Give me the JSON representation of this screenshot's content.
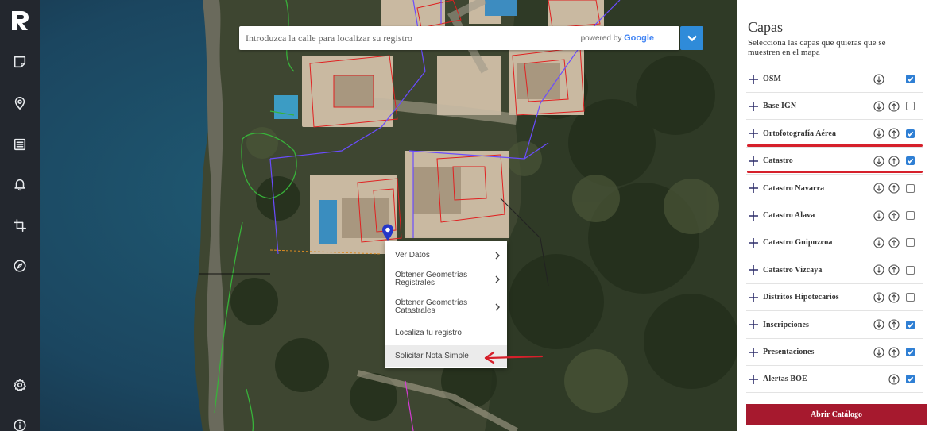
{
  "sidebar": {
    "logo_icon": "r-logo-icon",
    "items": [
      {
        "name": "notes-icon"
      },
      {
        "name": "location-pin-icon"
      },
      {
        "name": "list-icon"
      },
      {
        "name": "bell-icon"
      },
      {
        "name": "crop-icon"
      },
      {
        "name": "compass-icon"
      }
    ],
    "bottom": [
      {
        "name": "gear-icon"
      },
      {
        "name": "info-icon"
      }
    ]
  },
  "search": {
    "placeholder": "Introduzca la calle para localizar su registro",
    "powered_prefix": "powered by",
    "powered_brand": "Google",
    "button_icon": "chevron-down-icon"
  },
  "context_menu": {
    "items": [
      {
        "label": "Ver Datos",
        "has_arrow": true
      },
      {
        "label_line1": "Obtener Geometrías",
        "label_line2": "Registrales",
        "has_arrow": true
      },
      {
        "label_line1": "Obtener Geometrías",
        "label_line2": "Catastrales",
        "has_arrow": true
      },
      {
        "label": "Localiza tu registro",
        "has_arrow": false
      },
      {
        "label": "Solicitar Nota Simple",
        "has_arrow": false,
        "highlighted": true
      }
    ]
  },
  "panel": {
    "title": "Capas",
    "subtitle": "Selecciona las capas que quieras que se muestren en el mapa",
    "layers": [
      {
        "label": "OSM",
        "download": true,
        "upload": false,
        "checked": true
      },
      {
        "label": "Base IGN",
        "download": true,
        "upload": true,
        "checked": false
      },
      {
        "label": "Ortofotografía Aérea",
        "download": true,
        "upload": true,
        "checked": true,
        "underlined": true
      },
      {
        "label": "Catastro",
        "download": true,
        "upload": true,
        "checked": true,
        "underlined": true
      },
      {
        "label": "Catastro Navarra",
        "download": true,
        "upload": true,
        "checked": false
      },
      {
        "label": "Catastro Alava",
        "download": true,
        "upload": true,
        "checked": false
      },
      {
        "label": "Catastro Guipuzcoa",
        "download": true,
        "upload": true,
        "checked": false
      },
      {
        "label": "Catastro Vizcaya",
        "download": true,
        "upload": true,
        "checked": false
      },
      {
        "label": "Distritos Hipotecarios",
        "download": true,
        "upload": true,
        "checked": false
      },
      {
        "label": "Inscripciones",
        "download": true,
        "upload": true,
        "checked": true
      },
      {
        "label": "Presentaciones",
        "download": true,
        "upload": true,
        "checked": true
      },
      {
        "label": "Alertas BOE",
        "download": false,
        "upload": true,
        "checked": true
      }
    ],
    "catalog_button": "Abrir Catálogo"
  },
  "colors": {
    "sidebar": "#23272e",
    "accent_blue": "#2f8bd9",
    "catalog_button": "#a6192e",
    "highlight_red": "#d6202b",
    "checkbox_on": "#2f7fd4"
  }
}
